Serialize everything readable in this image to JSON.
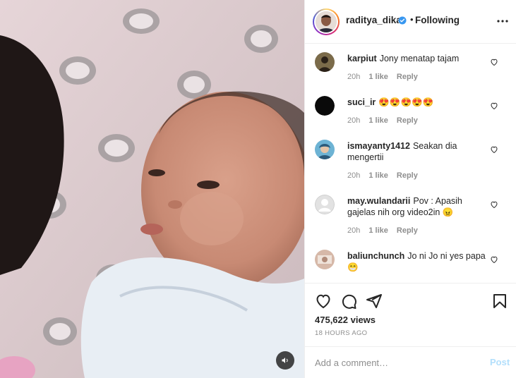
{
  "post": {
    "username": "raditya_dika",
    "separator": "•",
    "follow_status": "Following",
    "views": "475,622 views",
    "time_ago": "18 HOURS AGO"
  },
  "comments": [
    {
      "user": "karpiut",
      "text": "Jony menatap tajam",
      "time": "20h",
      "likes": "1 like",
      "reply": "Reply",
      "avatar_color": "#6b5a3e"
    },
    {
      "user": "suci_ir",
      "text": "😍😍😍😍😍",
      "time": "20h",
      "likes": "1 like",
      "reply": "Reply",
      "avatar_color": "#0a0a0a"
    },
    {
      "user": "ismayanty1412",
      "text": "Seakan dia mengertii",
      "time": "20h",
      "likes": "1 like",
      "reply": "Reply",
      "avatar_color": "#5aa6c8"
    },
    {
      "user": "may.wulandarii",
      "text": "Pov : Apasih gajelas nih org video2in 😠",
      "time": "20h",
      "likes": "1 like",
      "reply": "Reply",
      "avatar_color": "#dcdcdc"
    },
    {
      "user": "baliunchunch",
      "text": "Jo ni Jo ni yes papa 😁",
      "time": "",
      "likes": "",
      "reply": "",
      "avatar_color": "#c9a99a"
    }
  ],
  "add_comment": {
    "placeholder": "Add a comment…",
    "post_label": "Post"
  },
  "icons": {
    "verified": "verified-badge-icon",
    "more": "more-options-icon",
    "like": "heart-icon",
    "comment": "comment-icon",
    "share": "share-icon",
    "save": "bookmark-icon",
    "mute": "speaker-icon"
  },
  "colors": {
    "accent_blue": "#0095f6",
    "post_disabled": "#b2dffc",
    "meta_gray": "#8e8e8e",
    "text": "#262626",
    "divider": "#efefef"
  }
}
